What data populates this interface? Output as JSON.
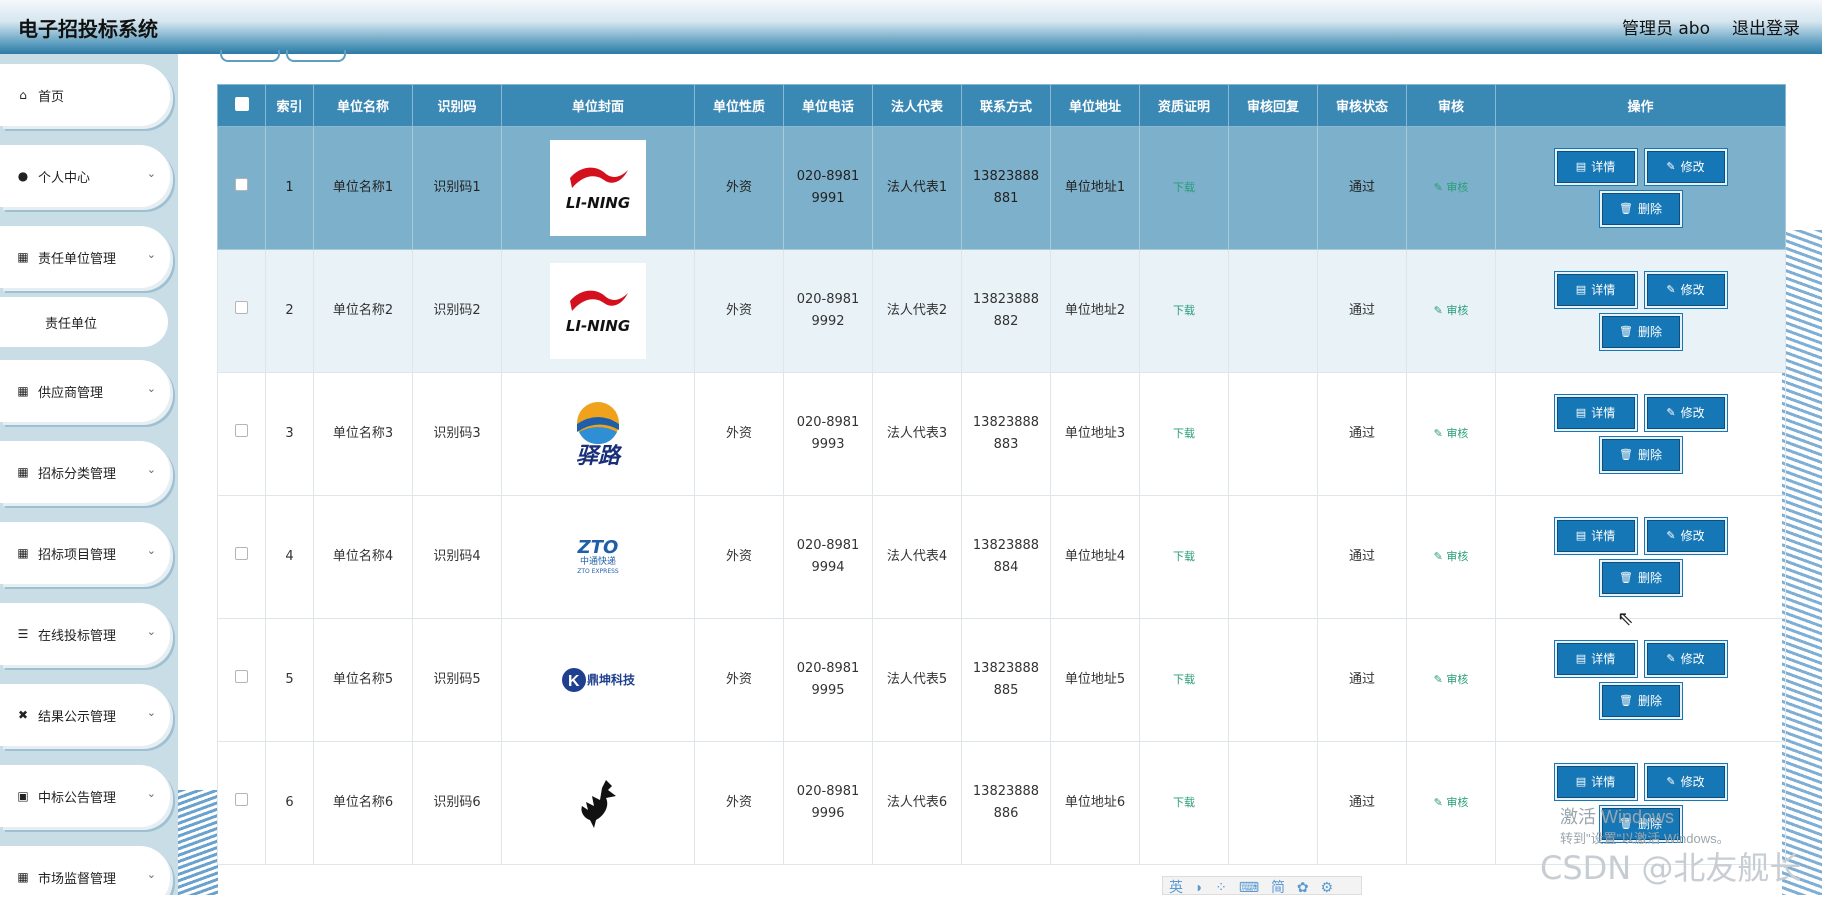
{
  "header": {
    "title": "电子招投标系统",
    "user_label": "管理员 abo",
    "logout_label": "退出登录"
  },
  "sidebar": {
    "items": [
      {
        "label": "首页",
        "icon": "home-icon"
      },
      {
        "label": "个人中心",
        "icon": "user-icon"
      },
      {
        "label": "责任单位管理",
        "icon": "grid-icon"
      },
      {
        "label": "责任单位",
        "icon": ""
      },
      {
        "label": "供应商管理",
        "icon": "grid-icon"
      },
      {
        "label": "招标分类管理",
        "icon": "grid-icon"
      },
      {
        "label": "招标项目管理",
        "icon": "grid-icon"
      },
      {
        "label": "在线投标管理",
        "icon": "list-icon"
      },
      {
        "label": "结果公示管理",
        "icon": "ticket-icon"
      },
      {
        "label": "中标公告管理",
        "icon": "briefcase-icon"
      },
      {
        "label": "市场监督管理",
        "icon": "grid-icon"
      }
    ]
  },
  "table": {
    "headers": [
      "",
      "索引",
      "单位名称",
      "识别码",
      "单位封面",
      "单位性质",
      "单位电话",
      "法人代表",
      "联系方式",
      "单位地址",
      "资质证明",
      "审核回复",
      "审核状态",
      "审核",
      "操作"
    ],
    "rows": [
      {
        "index": "1",
        "name": "单位名称1",
        "code": "识别码1",
        "logo": "li-ning-logo",
        "nature": "外资",
        "phone1": "020-8981",
        "phone2": "9991",
        "rep": "法人代表1",
        "contact1": "13823888",
        "contact2": "881",
        "addr": "单位地址1",
        "cert": "下载",
        "reply": "",
        "status": "通过",
        "audit": "审核"
      },
      {
        "index": "2",
        "name": "单位名称2",
        "code": "识别码2",
        "logo": "li-ning-logo",
        "nature": "外资",
        "phone1": "020-8981",
        "phone2": "9992",
        "rep": "法人代表2",
        "contact1": "13823888",
        "contact2": "882",
        "addr": "单位地址2",
        "cert": "下载",
        "reply": "",
        "status": "通过",
        "audit": "审核"
      },
      {
        "index": "3",
        "name": "单位名称3",
        "code": "识别码3",
        "logo": "yizhan-logo",
        "nature": "外资",
        "phone1": "020-8981",
        "phone2": "9993",
        "rep": "法人代表3",
        "contact1": "13823888",
        "contact2": "883",
        "addr": "单位地址3",
        "cert": "下载",
        "reply": "",
        "status": "通过",
        "audit": "审核"
      },
      {
        "index": "4",
        "name": "单位名称4",
        "code": "识别码4",
        "logo": "zto-logo",
        "nature": "外资",
        "phone1": "020-8981",
        "phone2": "9994",
        "rep": "法人代表4",
        "contact1": "13823888",
        "contact2": "884",
        "addr": "单位地址4",
        "cert": "下载",
        "reply": "",
        "status": "通过",
        "audit": "审核"
      },
      {
        "index": "5",
        "name": "单位名称5",
        "code": "识别码5",
        "logo": "dingkun-logo",
        "nature": "外资",
        "phone1": "020-8981",
        "phone2": "9995",
        "rep": "法人代表5",
        "contact1": "13823888",
        "contact2": "885",
        "addr": "单位地址5",
        "cert": "下载",
        "reply": "",
        "status": "通过",
        "audit": "审核"
      },
      {
        "index": "6",
        "name": "单位名称6",
        "code": "识别码6",
        "logo": "bird-logo",
        "nature": "外资",
        "phone1": "020-8981",
        "phone2": "9996",
        "rep": "法人代表6",
        "contact1": "13823888",
        "contact2": "886",
        "addr": "单位地址6",
        "cert": "下载",
        "reply": "",
        "status": "通过",
        "audit": "审核"
      }
    ],
    "actions": {
      "detail": "详情",
      "edit": "修改",
      "delete": "删除"
    }
  },
  "logos": {
    "li_ning_text": "LI-NING",
    "zto_text": "ZTO",
    "zto_sub": "中通快递",
    "zto_en": "ZTO EXPRESS",
    "dingkun_text": "鼎坤科技",
    "yizhan_text": "驿路"
  },
  "overlay": {
    "activate_title": "激活 Windows",
    "activate_sub": "转到\"设置\"以激活 Windows。",
    "csdn_text": "CSDN @北友舰长",
    "ime_text": "英 ◗ ⁘ ⌨ 简 ✿ ⚙"
  },
  "colors": {
    "header_bg": "#3a88b4",
    "selected_row": "#7db0cb",
    "button": "#1677b6",
    "link_green": "#2a9d7a"
  }
}
